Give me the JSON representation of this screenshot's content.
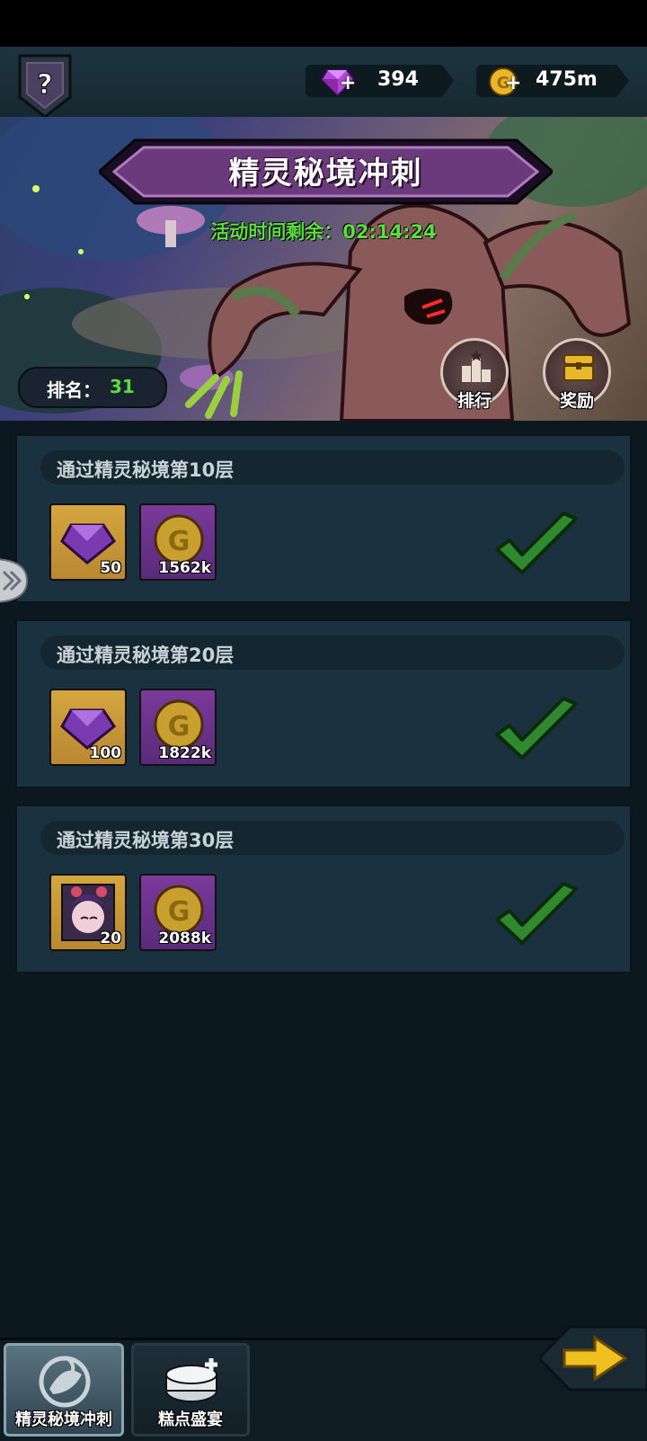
{
  "currencies": {
    "gems": "394",
    "gold": "475m"
  },
  "event": {
    "title": "精灵秘境冲刺",
    "timer_label": "活动时间剩余：",
    "timer_value": "02:14:24",
    "rank_label": "排名：",
    "rank_value": "31",
    "rank_button_label": "排行",
    "reward_button_label": "奖励"
  },
  "tasks": [
    {
      "title": "通过精灵秘境第10层",
      "rewards": [
        {
          "type": "gem",
          "qty": "50"
        },
        {
          "type": "gold",
          "qty": "1562k"
        }
      ],
      "completed": true
    },
    {
      "title": "通过精灵秘境第20层",
      "rewards": [
        {
          "type": "gem",
          "qty": "100"
        },
        {
          "type": "gold",
          "qty": "1822k"
        }
      ],
      "completed": true
    },
    {
      "title": "通过精灵秘境第30层",
      "rewards": [
        {
          "type": "hero-shard",
          "qty": "20"
        },
        {
          "type": "gold",
          "qty": "2088k"
        }
      ],
      "completed": true
    }
  ],
  "bottom_tabs": [
    {
      "label": "精灵秘境冲刺",
      "selected": true
    },
    {
      "label": "糕点盛宴",
      "selected": false
    }
  ],
  "colors": {
    "accent_green": "#5adf3c",
    "check_green": "#2f8a2f",
    "panel": "#1a3240"
  }
}
